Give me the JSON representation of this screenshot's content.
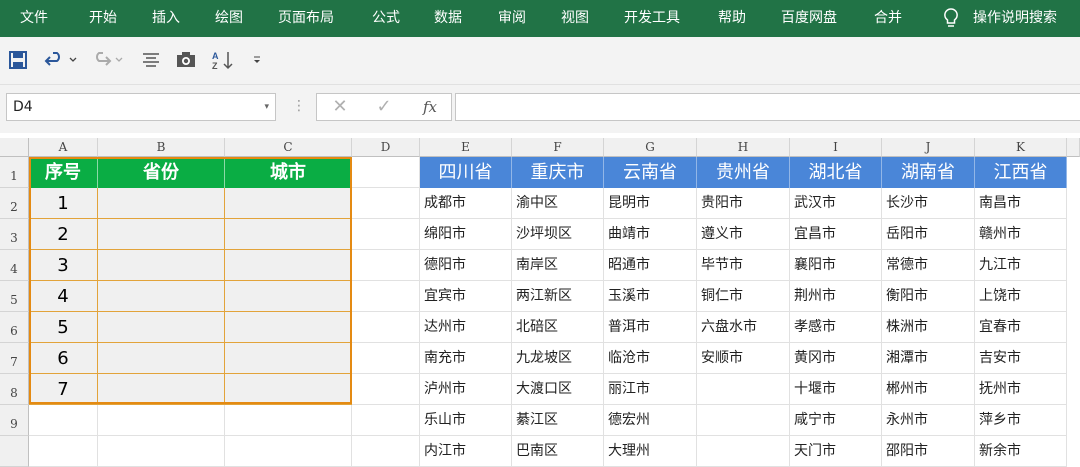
{
  "ribbon": {
    "tabs": [
      "文件",
      "开始",
      "插入",
      "绘图",
      "页面布局",
      "公式",
      "数据",
      "审阅",
      "视图",
      "开发工具",
      "帮助",
      "百度网盘",
      "合并"
    ],
    "tell_me": "操作说明搜索"
  },
  "qat": {
    "icons": [
      "save-icon",
      "undo-icon",
      "redo-icon",
      "align-icon",
      "camera-icon",
      "sort-az-icon",
      "customize-qat-icon"
    ]
  },
  "formula_bar": {
    "name_box": "D4",
    "cancel": "✕",
    "enter": "✓",
    "fx": "fx",
    "value": ""
  },
  "sheet": {
    "columns": [
      "A",
      "B",
      "C",
      "D",
      "E",
      "F",
      "G",
      "H",
      "I",
      "J",
      "K"
    ],
    "rows": [
      "1",
      "2",
      "3",
      "4",
      "5",
      "6",
      "7",
      "8",
      "9"
    ],
    "table_headers": [
      "序号",
      "省份",
      "城市"
    ],
    "index_values": [
      "1",
      "2",
      "3",
      "4",
      "5",
      "6",
      "7"
    ],
    "provinces": [
      "四川省",
      "重庆市",
      "云南省",
      "贵州省",
      "湖北省",
      "湖南省",
      "江西省"
    ],
    "cities": [
      [
        "成都市",
        "渝中区",
        "昆明市",
        "贵阳市",
        "武汉市",
        "长沙市",
        "南昌市"
      ],
      [
        "绵阳市",
        "沙坪坝区",
        "曲靖市",
        "遵义市",
        "宜昌市",
        "岳阳市",
        "赣州市"
      ],
      [
        "德阳市",
        "南岸区",
        "昭通市",
        "毕节市",
        "襄阳市",
        "常德市",
        "九江市"
      ],
      [
        "宜宾市",
        "两江新区",
        "玉溪市",
        "铜仁市",
        "荆州市",
        "衡阳市",
        "上饶市"
      ],
      [
        "达州市",
        "北碚区",
        "普洱市",
        "六盘水市",
        "孝感市",
        "株洲市",
        "宜春市"
      ],
      [
        "南充市",
        "九龙坡区",
        "临沧市",
        "安顺市",
        "黄冈市",
        "湘潭市",
        "吉安市"
      ],
      [
        "泸州市",
        "大渡口区",
        "丽江市",
        "",
        "十堰市",
        "郴州市",
        "抚州市"
      ],
      [
        "乐山市",
        "綦江区",
        "德宏州",
        "",
        "咸宁市",
        "永州市",
        "萍乡市"
      ],
      [
        "内江市",
        "巴南区",
        "大理州",
        "",
        "天门市",
        "邵阳市",
        "新余市"
      ]
    ]
  }
}
